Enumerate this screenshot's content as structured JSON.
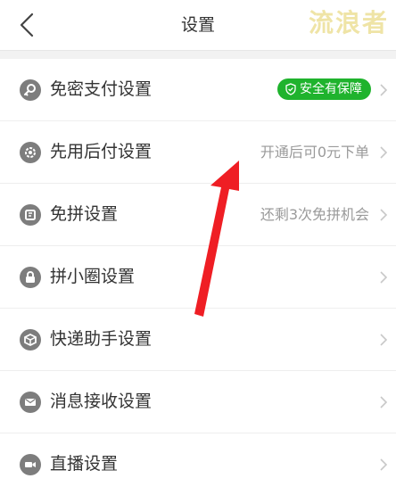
{
  "header": {
    "title": "设置",
    "watermark": "流浪者"
  },
  "items": [
    {
      "label": "免密支付设置",
      "badge": "安全有保障",
      "icon": "key-icon"
    },
    {
      "label": "先用后付设置",
      "value": "开通后可0元下单",
      "icon": "gear-icon"
    },
    {
      "label": "免拼设置",
      "value": "还剩3次免拼机会",
      "icon": "coupon-icon"
    },
    {
      "label": "拼小圈设置",
      "icon": "lock-icon"
    },
    {
      "label": "快递助手设置",
      "icon": "package-icon"
    },
    {
      "label": "消息接收设置",
      "icon": "mail-icon"
    },
    {
      "label": "直播设置",
      "icon": "video-icon"
    }
  ],
  "colors": {
    "badge_green": "#1fb32d",
    "annotation_arrow": "#ef1e24",
    "icon_gray": "#7d7d7d"
  }
}
